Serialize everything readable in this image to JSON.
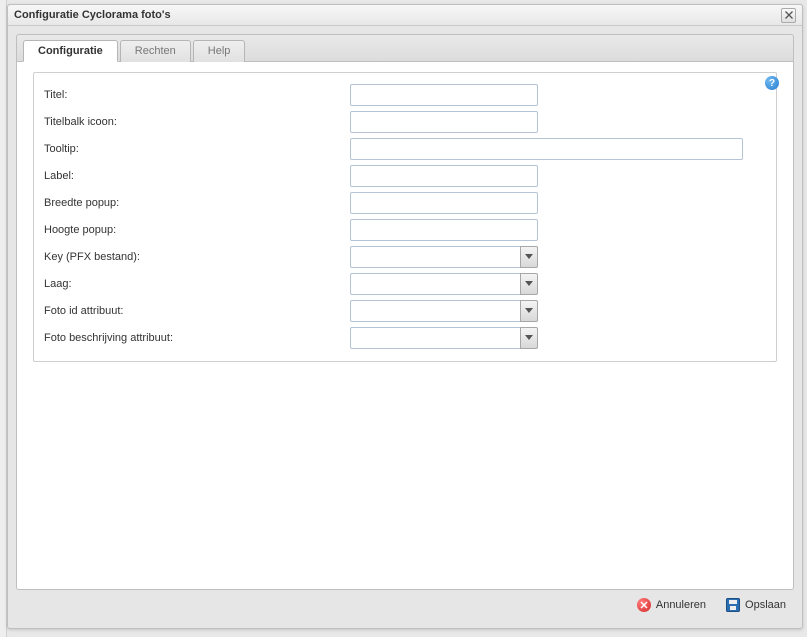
{
  "window": {
    "title": "Configuratie Cyclorama foto's"
  },
  "tabs": [
    {
      "label": "Configuratie",
      "active": true
    },
    {
      "label": "Rechten",
      "active": false
    },
    {
      "label": "Help",
      "active": false
    }
  ],
  "form": {
    "rows": [
      {
        "label": "Titel:",
        "type": "text",
        "value": "",
        "width": "normal"
      },
      {
        "label": "Titelbalk icoon:",
        "type": "text",
        "value": "",
        "width": "normal"
      },
      {
        "label": "Tooltip:",
        "type": "text",
        "value": "",
        "width": "wide"
      },
      {
        "label": "Label:",
        "type": "text",
        "value": "",
        "width": "normal"
      },
      {
        "label": "Breedte popup:",
        "type": "text",
        "value": "",
        "width": "normal"
      },
      {
        "label": "Hoogte popup:",
        "type": "text",
        "value": "",
        "width": "normal"
      },
      {
        "label": "Key (PFX bestand):",
        "type": "combo",
        "value": ""
      },
      {
        "label": "Laag:",
        "type": "combo",
        "value": ""
      },
      {
        "label": "Foto id attribuut:",
        "type": "combo",
        "value": ""
      },
      {
        "label": "Foto beschrijving attribuut:",
        "type": "combo",
        "value": ""
      }
    ]
  },
  "help_icon": "?",
  "footer": {
    "cancel_label": "Annuleren",
    "save_label": "Opslaan"
  }
}
